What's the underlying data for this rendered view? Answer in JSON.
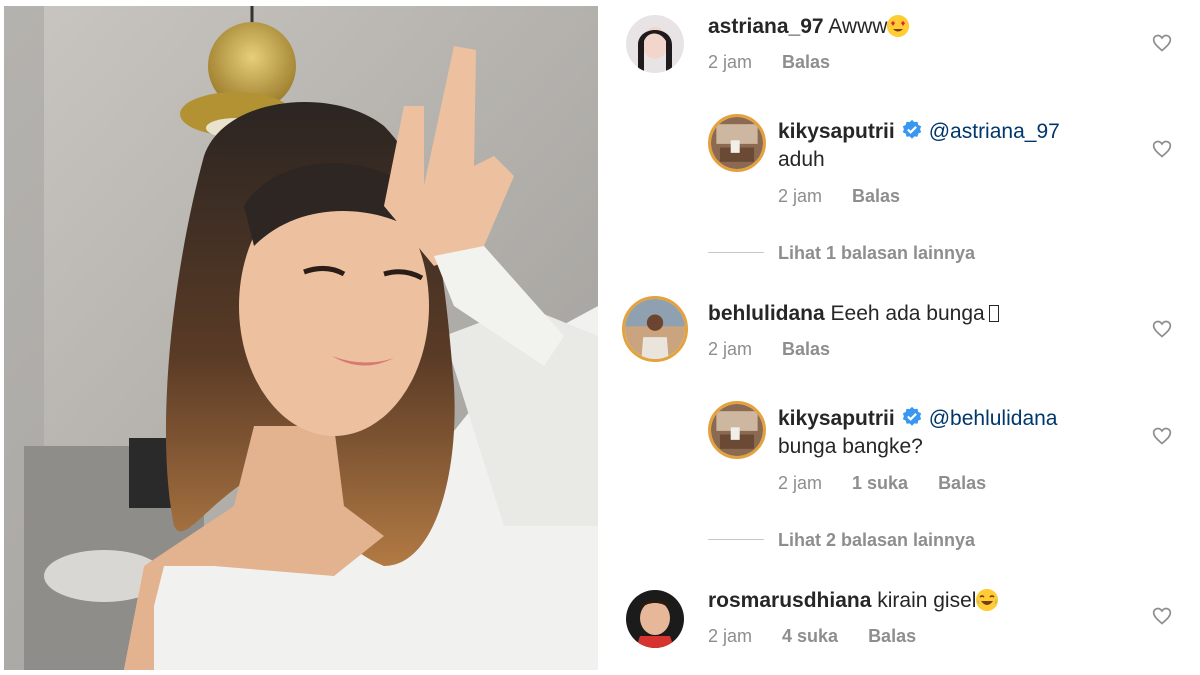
{
  "colors": {
    "username": "#262626",
    "mention": "#00376b",
    "meta": "#8e8e8e",
    "verified": "#3897f0",
    "story_ring": "#e4a23c"
  },
  "comments": [
    {
      "username": "astriana_97",
      "text": "Awww",
      "emoji": "heart-eyes-emoji",
      "time": "2 jam",
      "reply_label": "Balas",
      "replies": [
        {
          "username": "kikysaputrii",
          "verified": true,
          "mention": "@astriana_97",
          "text": "aduh",
          "time": "2 jam",
          "reply_label": "Balas"
        }
      ],
      "more_replies": "Lihat 1 balasan lainnya"
    },
    {
      "username": "behlulidana",
      "text": "Eeeh ada bunga",
      "time": "2 jam",
      "reply_label": "Balas",
      "replies": [
        {
          "username": "kikysaputrii",
          "verified": true,
          "mention": "@behlulidana",
          "text": "bunga bangke?",
          "time": "2 jam",
          "likes": "1 suka",
          "reply_label": "Balas"
        }
      ],
      "more_replies": "Lihat 2 balasan lainnya"
    },
    {
      "username": "rosmarusdhiana",
      "text": "kirain gisel",
      "emoji": "laughing-emoji",
      "time": "2 jam",
      "likes": "4 suka",
      "reply_label": "Balas"
    }
  ]
}
